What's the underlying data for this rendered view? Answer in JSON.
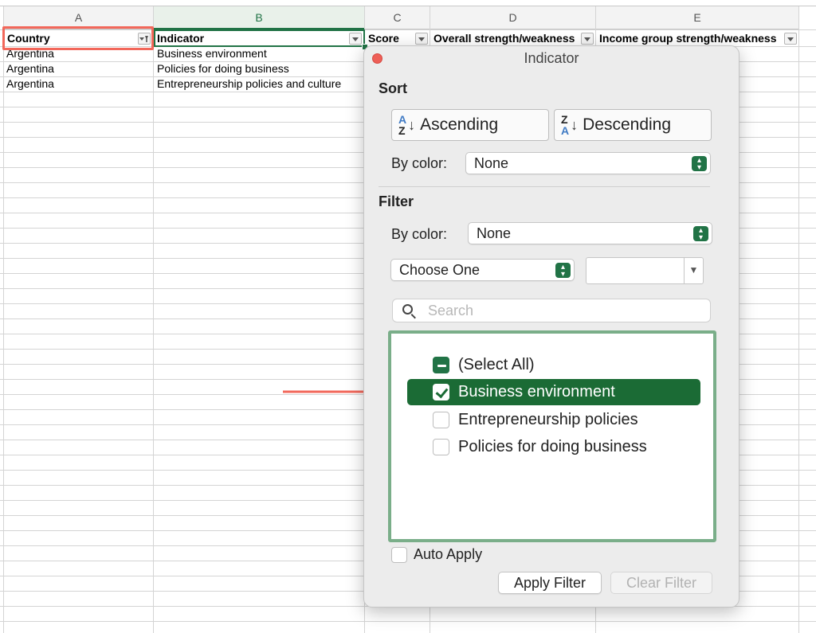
{
  "sheet": {
    "column_letters": [
      "A",
      "B",
      "C",
      "D",
      "E"
    ],
    "header_cells": [
      "Country",
      "Indicator",
      "Score",
      "Overall strength/weakness",
      "Income group strength/weakness"
    ],
    "rows": [
      [
        "Argentina",
        "Business environment"
      ],
      [
        "Argentina",
        "Policies for doing business"
      ],
      [
        "Argentina",
        "Entrepreneurship policies and culture"
      ]
    ]
  },
  "panel": {
    "title": "Indicator",
    "sort": {
      "heading": "Sort",
      "ascending_label": "Ascending",
      "descending_label": "Descending",
      "by_color_label": "By color:",
      "by_color_value": "None"
    },
    "filter": {
      "heading": "Filter",
      "by_color_label": "By color:",
      "by_color_value": "None",
      "condition_value": "Choose One",
      "search_placeholder": "Search",
      "items": [
        {
          "label": "(Select All)",
          "state": "mixed"
        },
        {
          "label": "Business environment",
          "state": "checked"
        },
        {
          "label": "Entrepreneurship policies",
          "state": "unchecked"
        },
        {
          "label": "Policies for doing business",
          "state": "unchecked"
        }
      ],
      "auto_apply_label": "Auto Apply",
      "apply_label": "Apply Filter",
      "clear_label": "Clear Filter"
    }
  },
  "colors": {
    "accent_green": "#217346",
    "highlight_green": "#1b6b35",
    "annotation_red": "#f2675a",
    "list_border": "#7aae89"
  }
}
